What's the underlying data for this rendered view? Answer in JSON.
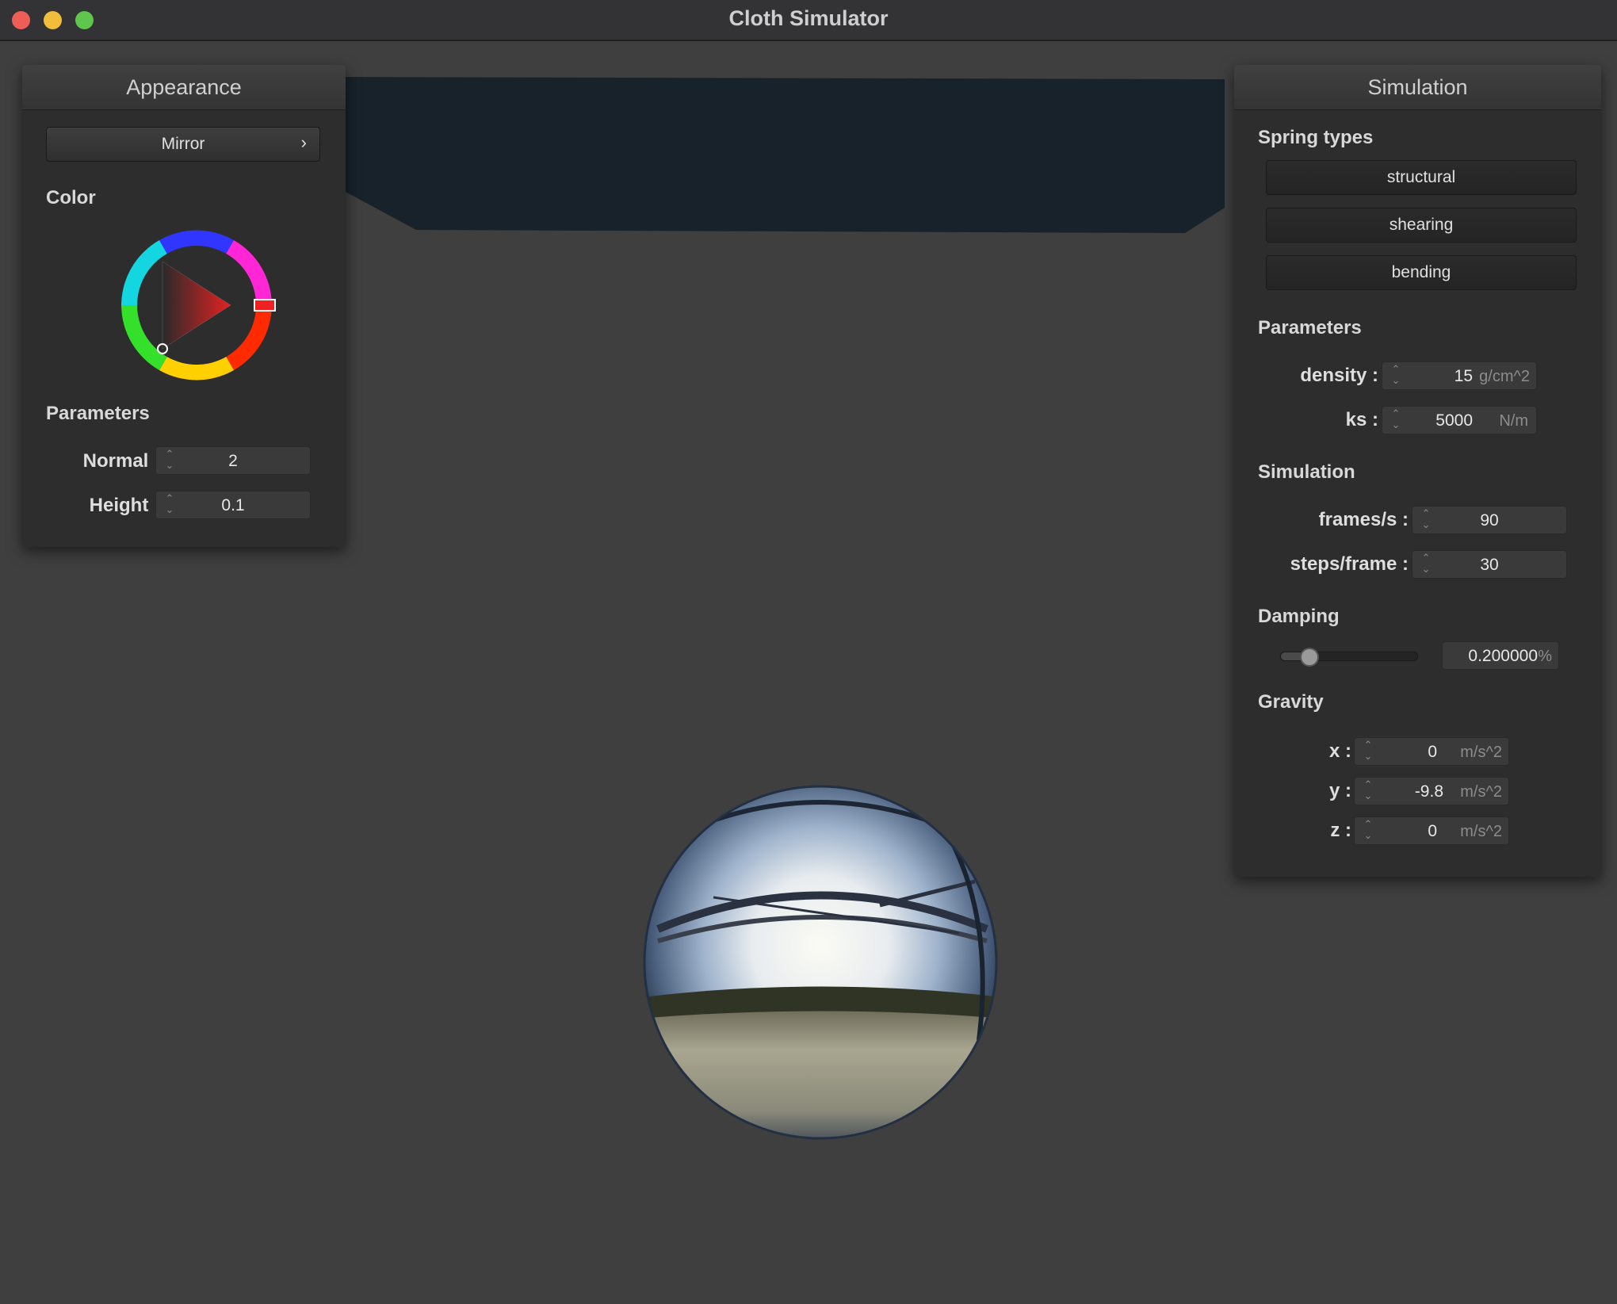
{
  "window": {
    "title": "Cloth Simulator"
  },
  "appearance": {
    "title": "Appearance",
    "shader_select": {
      "value": "Mirror",
      "icon": "chevron-right-icon",
      "glyph": "›"
    },
    "color_label": "Color",
    "color_value": "#d42a2a",
    "parameters_label": "Parameters",
    "normal": {
      "label": "Normal :",
      "value": "2"
    },
    "height": {
      "label": "Height :",
      "value": "0.1"
    }
  },
  "simulation": {
    "title": "Simulation",
    "spring_types_label": "Spring types",
    "spring_buttons": [
      "structural",
      "shearing",
      "bending"
    ],
    "parameters_label": "Parameters",
    "density": {
      "label": "density :",
      "value": "15",
      "unit": "g/cm^2"
    },
    "ks": {
      "label": "ks :",
      "value": "5000",
      "unit": "N/m"
    },
    "simulation_label": "Simulation",
    "fps": {
      "label": "frames/s :",
      "value": "90"
    },
    "steps": {
      "label": "steps/frame :",
      "value": "30"
    },
    "damping_label": "Damping",
    "damping": {
      "value": "0.200000",
      "unit": "%",
      "slider_fraction": 0.2
    },
    "gravity_label": "Gravity",
    "gx": {
      "label": "x :",
      "value": "0",
      "unit": "m/s^2"
    },
    "gy": {
      "label": "y :",
      "value": "-9.8",
      "unit": "m/s^2"
    },
    "gz": {
      "label": "z :",
      "value": "0",
      "unit": "m/s^2"
    }
  },
  "spinner_glyph": "⌃⌄",
  "colors": {
    "background": "#3f3f3f",
    "cloth": "#18222a",
    "panel": "#2d2d2d"
  }
}
